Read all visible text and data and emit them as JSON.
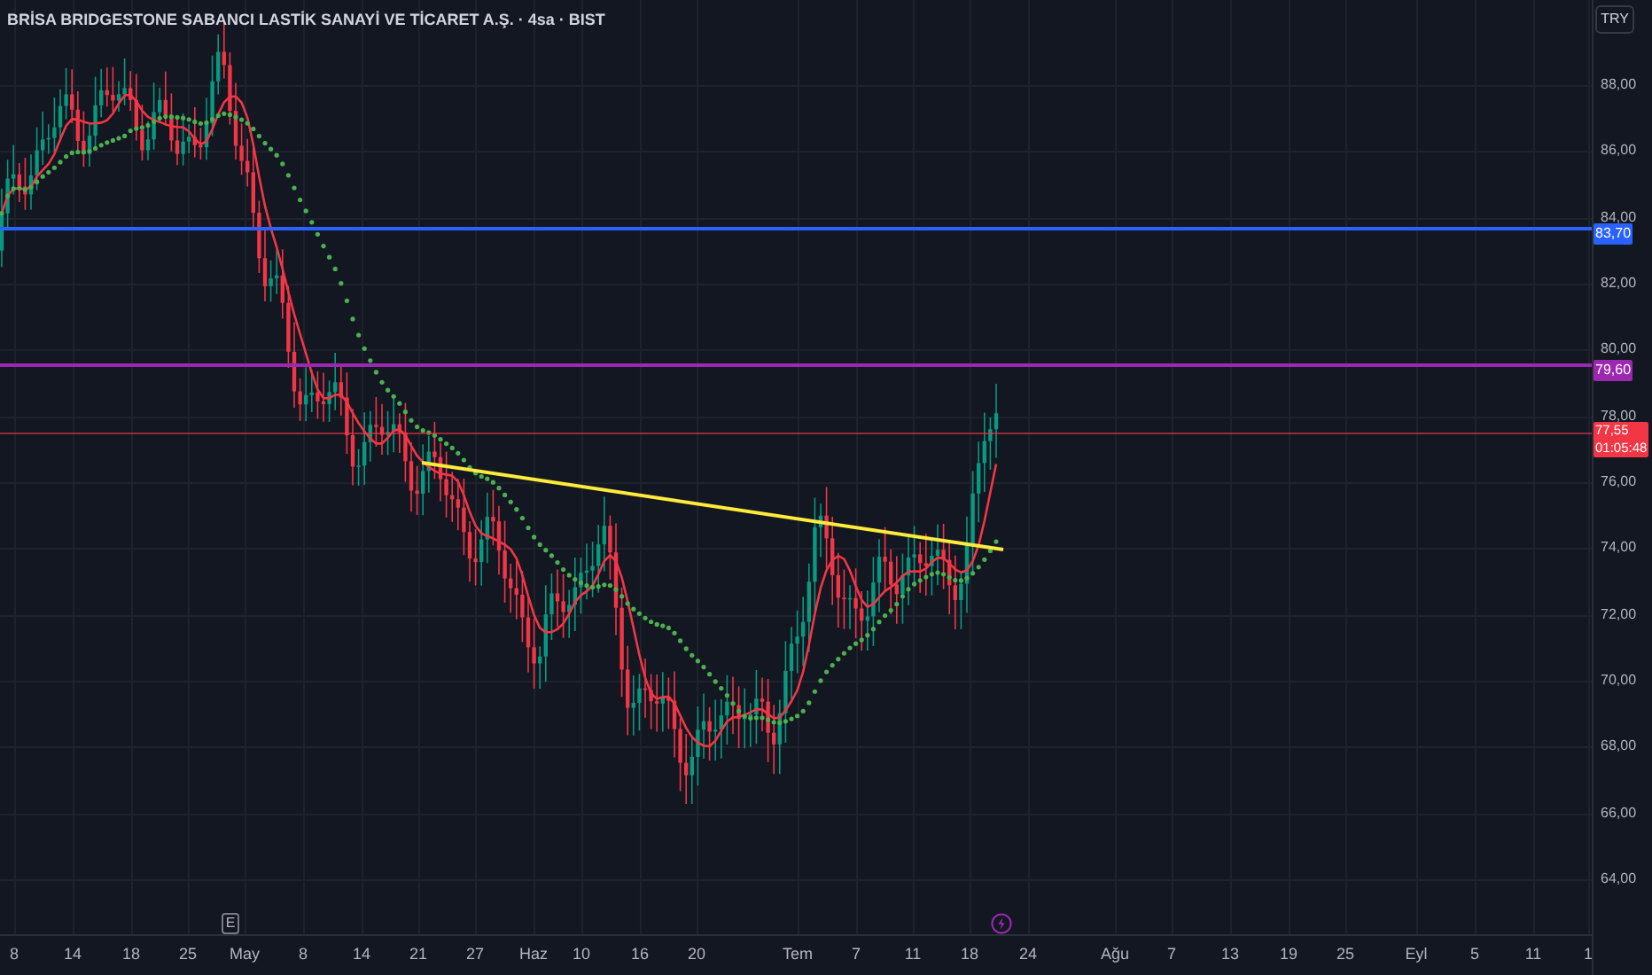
{
  "header": {
    "title": "BRİSA BRIDGESTONE SABANCI LASTİK SANAYİ VE TİCARET A.Ş. · 4sa · BIST"
  },
  "currency_button": {
    "label": "TRY"
  },
  "price_axis": {
    "labels": [
      "88,00",
      "86,00",
      "84,00",
      "82,00",
      "80,00",
      "78,00",
      "76,00",
      "74,00",
      "72,00",
      "70,00",
      "68,00",
      "66,00",
      "64,00"
    ]
  },
  "price_tags": [
    {
      "kind": "level",
      "label": "83,70",
      "color": "#2962ff"
    },
    {
      "kind": "level",
      "label": "79,60",
      "color": "#9c27b0"
    },
    {
      "kind": "last",
      "label": "77,55",
      "countdown": "01:05:48",
      "color": "#f23645"
    }
  ],
  "event_markers": [
    {
      "kind": "earnings",
      "label": "E"
    },
    {
      "kind": "dividend"
    }
  ],
  "time_axis": {
    "labels": [
      "8",
      "14",
      "18",
      "25",
      "May",
      "8",
      "14",
      "21",
      "27",
      "Haz",
      "10",
      "16",
      "20",
      "Tem",
      "7",
      "11",
      "18",
      "24",
      "Ağu",
      "7",
      "13",
      "19",
      "25",
      "Eyl",
      "5",
      "11",
      "1"
    ]
  }
}
